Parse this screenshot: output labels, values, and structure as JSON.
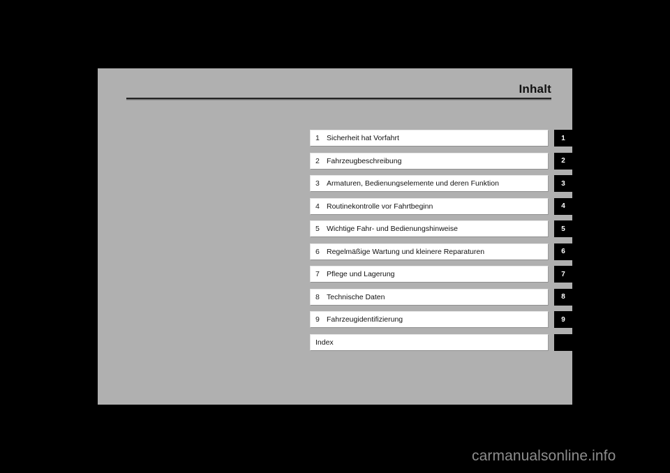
{
  "page": {
    "title": "Inhalt",
    "background_color": "#b0b0b0",
    "contents": [
      {
        "number": "1",
        "label": "Sicherheit hat Vorfahrt",
        "tab": "1"
      },
      {
        "number": "2",
        "label": "Fahrzeugbeschreibung",
        "tab": "2"
      },
      {
        "number": "3",
        "label": "Armaturen, Bedienungselemente und deren Funktion",
        "tab": "3"
      },
      {
        "number": "4",
        "label": "Routinekontrolle vor Fahrtbeginn",
        "tab": "4"
      },
      {
        "number": "5",
        "label": "Wichtige Fahr- und Bedienungshinweise",
        "tab": "5"
      },
      {
        "number": "6",
        "label": "Regelmäßige Wartung und kleinere Reparaturen",
        "tab": "6"
      },
      {
        "number": "7",
        "label": "Pflege und Lagerung",
        "tab": "7"
      },
      {
        "number": "8",
        "label": "Technische Daten",
        "tab": "8"
      },
      {
        "number": "9",
        "label": "Fahrzeugidentifizierung",
        "tab": "9"
      },
      {
        "number": "",
        "label": "Index",
        "tab": ""
      }
    ]
  },
  "watermark": {
    "text": "carmanualsonline.info",
    "color": "#8d8d8d"
  }
}
